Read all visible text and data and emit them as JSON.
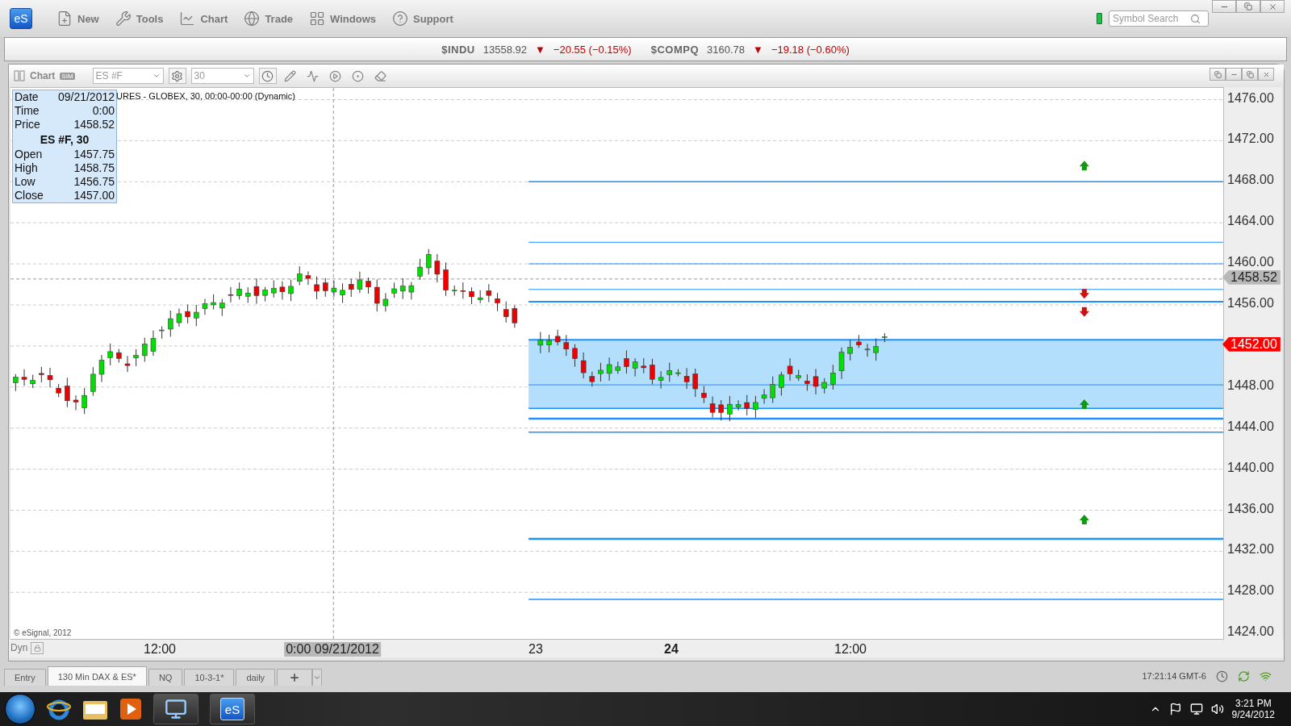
{
  "toolbar": {
    "logo": "eS",
    "menu": [
      {
        "label": "New",
        "kind": "new"
      },
      {
        "label": "Tools",
        "kind": "tools"
      },
      {
        "label": "Chart",
        "kind": "chart"
      },
      {
        "label": "Trade",
        "kind": "trade"
      },
      {
        "label": "Windows",
        "kind": "windows"
      },
      {
        "label": "Support",
        "kind": "support"
      }
    ],
    "search": {
      "placeholder": "Symbol Search"
    }
  },
  "ticker": [
    {
      "symbol": "$INDU",
      "price": "13558.92",
      "arrow": "▼",
      "change": "−20.55 (−0.15%)"
    },
    {
      "symbol": "$COMPQ",
      "price": "3160.78",
      "arrow": "▼",
      "change": "−19.18 (−0.60%)"
    }
  ],
  "chart_window": {
    "title": "Chart",
    "badge": "SIM",
    "symbol": "ES #F",
    "interval": "30",
    "legend": "URES - GLOBEX, 30, 00:00-00:00 (Dynamic)",
    "data_window": {
      "top_rows": [
        {
          "label": "Date",
          "value": "09/21/2012"
        },
        {
          "label": "Time",
          "value": "0:00"
        },
        {
          "label": "Price",
          "value": "1458.52"
        }
      ],
      "heading": "ES #F, 30",
      "rows": [
        {
          "label": "Open",
          "value": "1457.75"
        },
        {
          "label": "High",
          "value": "1458.75"
        },
        {
          "label": "Low",
          "value": "1456.75"
        },
        {
          "label": "Close",
          "value": "1457.00"
        }
      ]
    },
    "price_axis": [
      "1476.00",
      "1472.00",
      "1468.00",
      "1464.00",
      "1460.00",
      "1456.00",
      "1448.00",
      "1444.00",
      "1440.00",
      "1436.00",
      "1432.00",
      "1428.00",
      "1424.00"
    ],
    "price_markers": [
      {
        "label": "1458.52",
        "kind": "crosshair"
      },
      {
        "label": "1452.00",
        "kind": "last"
      }
    ],
    "time_axis": [
      {
        "label": "12:00",
        "kind": "time"
      },
      {
        "label": "0:00 09/21/2012",
        "kind": "crosshair"
      },
      {
        "label": "23",
        "kind": "time"
      },
      {
        "label": "24",
        "kind": "day"
      },
      {
        "label": "12:00",
        "kind": "time"
      }
    ],
    "copyright": "© eSignal, 2012",
    "scale_mode": "Dyn"
  },
  "tabs": [
    {
      "label": "Entry",
      "selected": false
    },
    {
      "label": "130 Min DAX & ES*",
      "selected": true
    },
    {
      "label": "NQ",
      "selected": false
    },
    {
      "label": "10-3-1*",
      "selected": false
    },
    {
      "label": "daily",
      "selected": false
    }
  ],
  "status_bar": {
    "time": "17:21:14 GMT-6"
  },
  "taskbar": {
    "app_label": "eS",
    "clock": "3:21 PM",
    "date": "9/24/2012"
  }
}
